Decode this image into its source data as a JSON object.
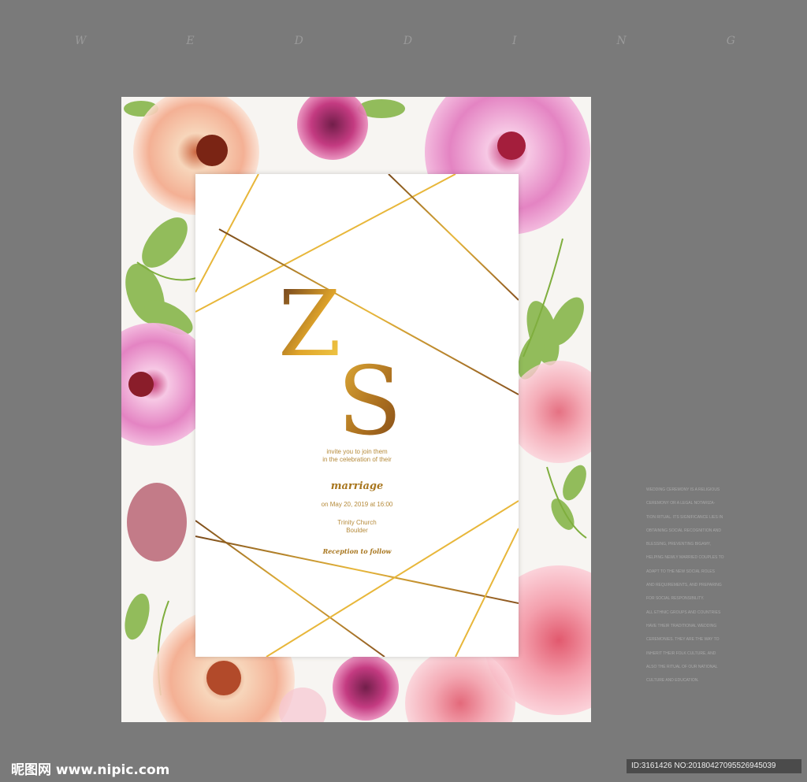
{
  "header": {
    "letters": [
      "W",
      "E",
      "D",
      "D",
      "I",
      "N",
      "G"
    ]
  },
  "card": {
    "monogram": {
      "first": "Z",
      "second": "S"
    },
    "invite_lines": [
      "invite you to join them",
      "in the celebration of their"
    ],
    "event_word": "marriage",
    "date_line": "on May 20, 2019 at 16:00",
    "venue_lines": [
      "Trinity Church",
      "Boulder"
    ],
    "closing": "Reception to follow"
  },
  "side_text": [
    "WEDDING CEREMONY IS A RELIGIOUS",
    "CEREMONY OR A LEGAL NOTARIZA-",
    "TION RITUAL. ITS SIGNIFICANCE LIES IN",
    "OBTAINING SOCIAL RECOGNITION AND",
    "BLESSING, PREVENTING BIGAMY,",
    "HELPING NEWLY MARRIED COUPLES TO",
    "ADAPT TO THE NEW SOCIAL ROLES",
    "AND REQUIREMENTS, AND PREPARING",
    "FOR SOCIAL RESPONSIBILITY.",
    "ALL ETHNIC GROUPS AND COUNTRIES",
    "HAVE THEIR TRADITIONAL WEDDING",
    "CEREMONIES. THEY ARE THE WAY TO",
    "INHERIT THEIR FOLK CULTURE, AND",
    "ALSO THE RITUAL OF OUR NATIONAL",
    "CULTURE AND EDUCATION."
  ],
  "footer": {
    "logo": "昵图网 www.nipic.com",
    "id_text": "ID:3161426 NO:20180427095526945039"
  },
  "colors": {
    "background": "#7a7a7a",
    "gold": "#b58a3a",
    "pink": "#e07ab8",
    "peach": "#f4b89a",
    "leaf": "#7fae3e"
  }
}
